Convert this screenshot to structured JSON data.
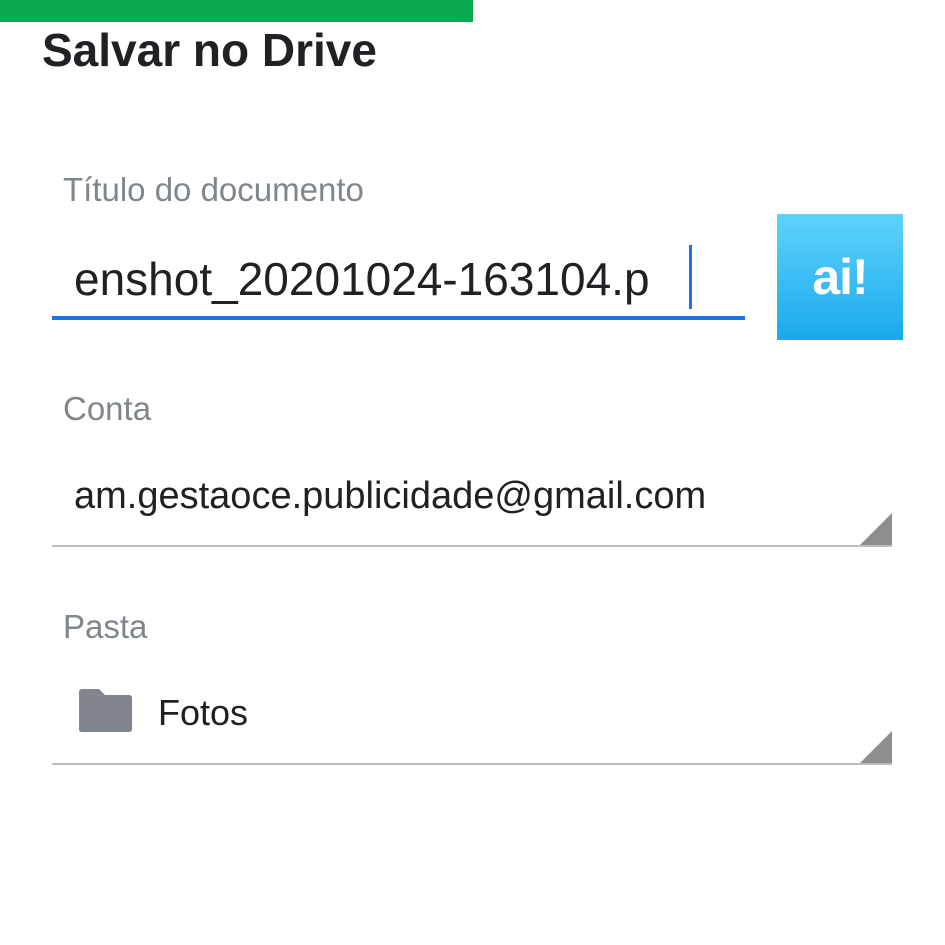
{
  "upload_progress": {
    "fraction": 0.5,
    "color": "#0aa84f"
  },
  "dialog": {
    "title": "Salvar no Drive"
  },
  "document_title": {
    "label": "Título do documento",
    "value": "enshot_20201024-163104.p",
    "accent_color": "#1a73e8"
  },
  "ai_button": {
    "label": "ai!",
    "colors": [
      "#5fd3fb",
      "#1aa9ec"
    ]
  },
  "account": {
    "label": "Conta",
    "value": "am.gestaoce.publicidade@gmail.com"
  },
  "folder": {
    "label": "Pasta",
    "value": "Fotos",
    "icon": "folder-icon",
    "icon_color": "#80868b"
  }
}
